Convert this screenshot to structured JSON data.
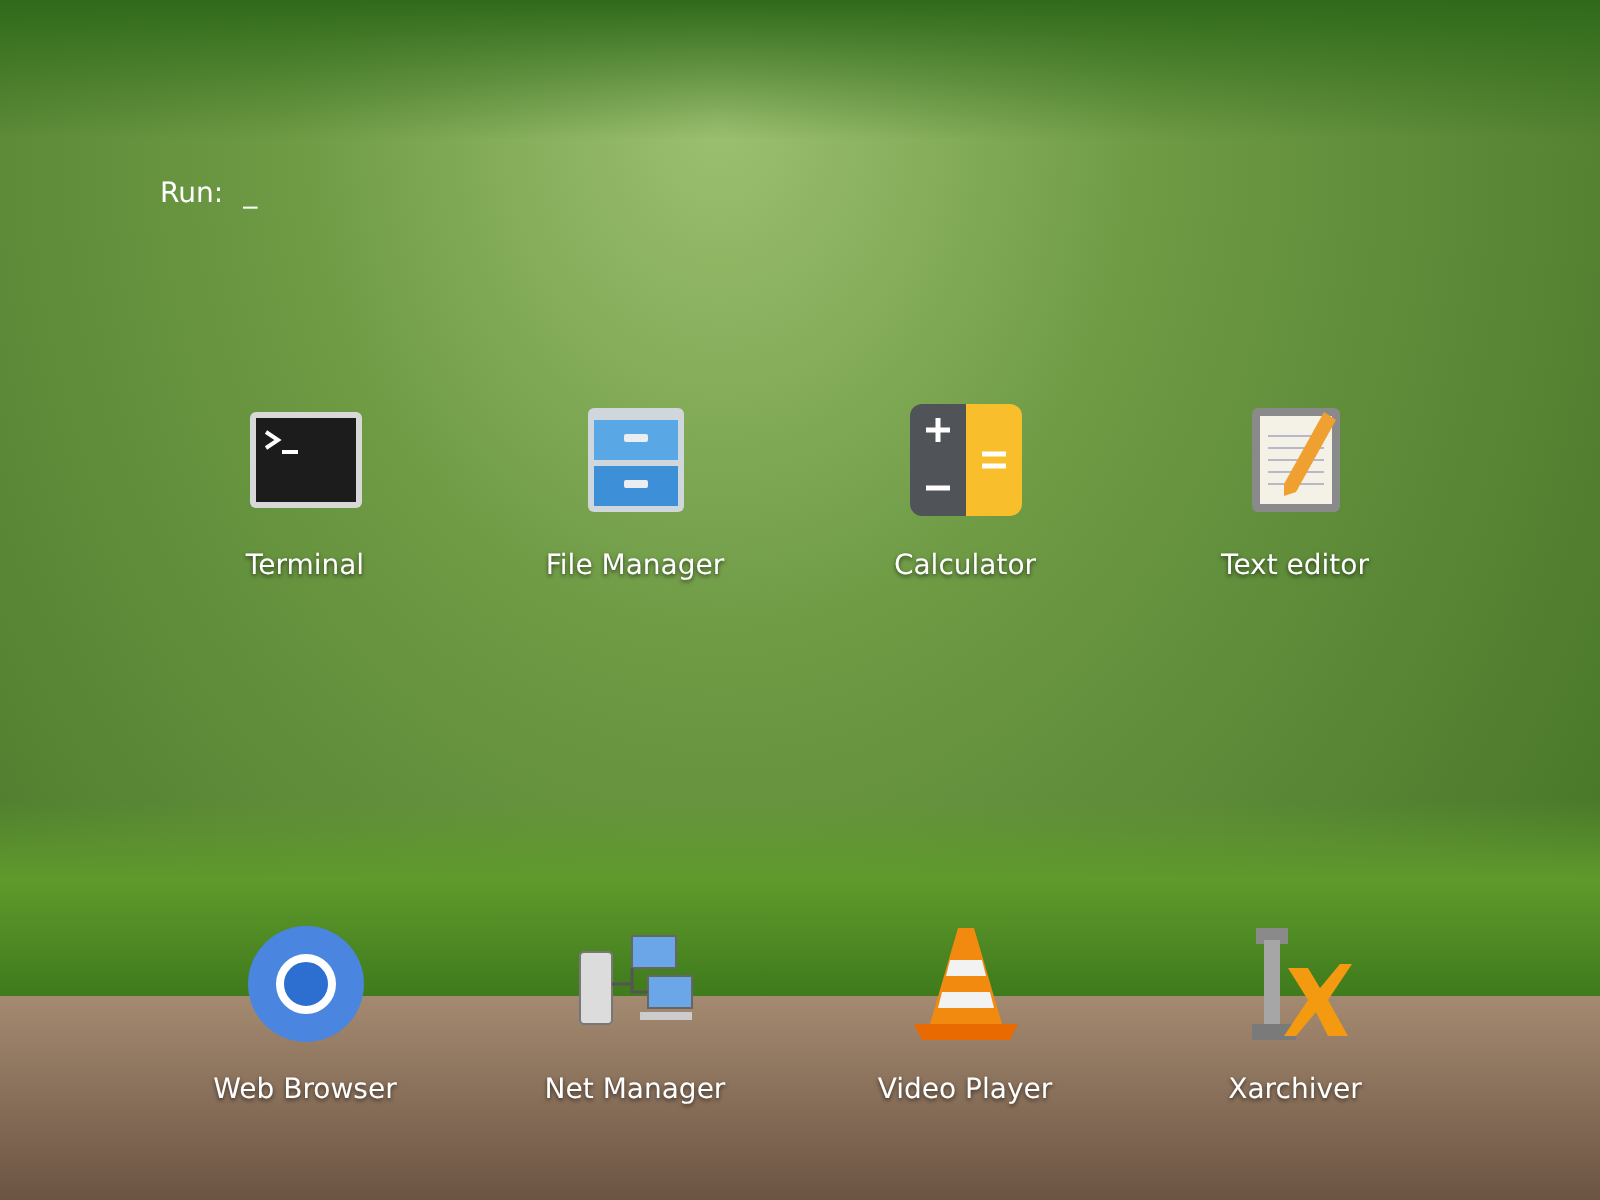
{
  "run_prompt": {
    "label": "Run:",
    "cursor": "_"
  },
  "apps": [
    {
      "label": "Terminal",
      "kind": "terminal"
    },
    {
      "label": "File Manager",
      "kind": "files"
    },
    {
      "label": "Calculator",
      "kind": "calculator"
    },
    {
      "label": "Text editor",
      "kind": "editor"
    },
    {
      "label": "Web Browser",
      "kind": "browser"
    },
    {
      "label": "Net Manager",
      "kind": "network"
    },
    {
      "label": "Video Player",
      "kind": "video"
    },
    {
      "label": "Xarchiver",
      "kind": "archive"
    }
  ]
}
